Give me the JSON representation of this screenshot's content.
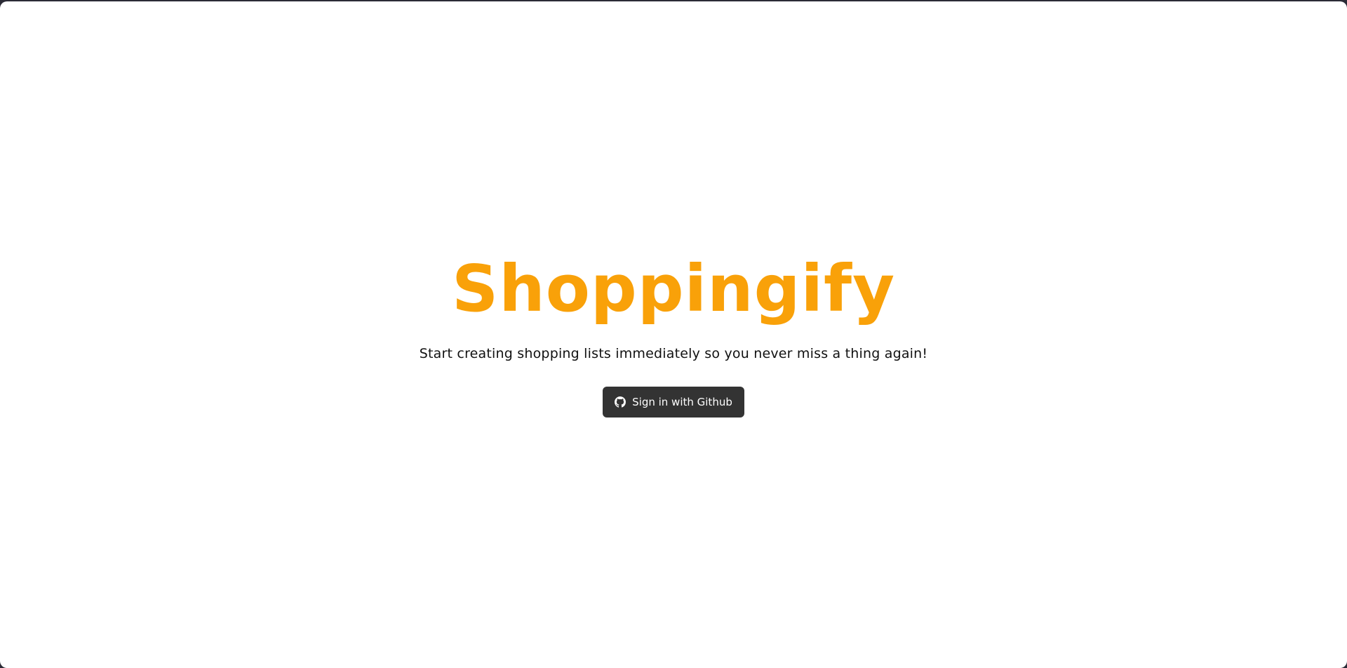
{
  "app": {
    "title": "Shoppingify",
    "tagline": "Start creating shopping lists immediately so you never miss a thing again!"
  },
  "auth": {
    "signin_label": "Sign in with Github",
    "signin_icon": "github-icon"
  },
  "colors": {
    "brand": "#f9a109",
    "button_bg": "#333333",
    "button_text": "#ffffff",
    "frame": "#2b2b36"
  }
}
